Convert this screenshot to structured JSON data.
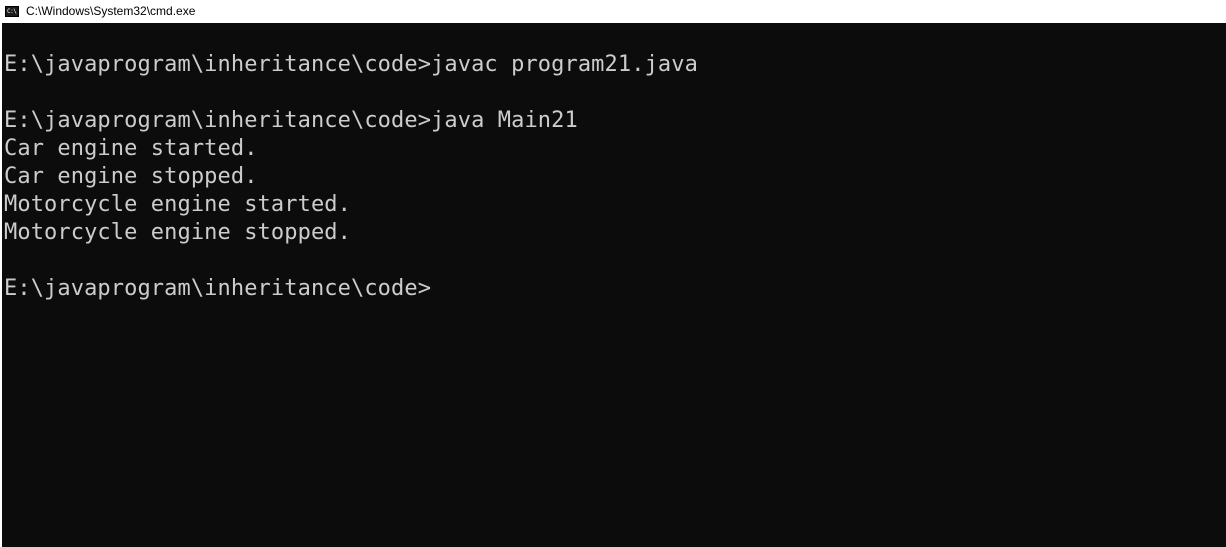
{
  "window": {
    "title": "C:\\Windows\\System32\\cmd.exe",
    "icon": "cmd-icon"
  },
  "console": {
    "lines": [
      "E:\\javaprogram\\inheritance\\code>javac program21.java",
      "",
      "E:\\javaprogram\\inheritance\\code>java Main21",
      "Car engine started.",
      "Car engine stopped.",
      "Motorcycle engine started.",
      "Motorcycle engine stopped.",
      "",
      "E:\\javaprogram\\inheritance\\code>"
    ],
    "colors": {
      "background": "#0c0c0c",
      "text": "#cccccc"
    }
  }
}
